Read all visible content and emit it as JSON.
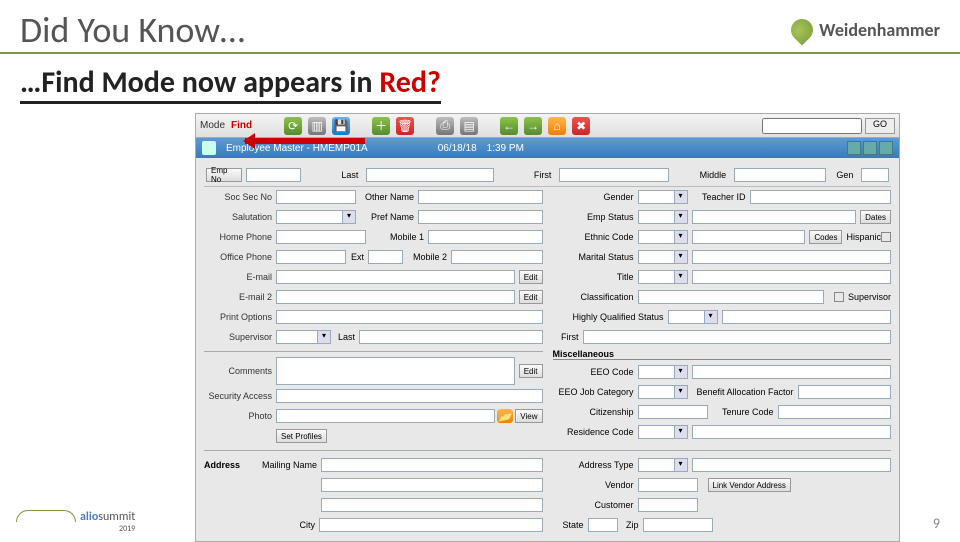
{
  "slide": {
    "title": "Did You Know…",
    "brand": "Weidenhammer",
    "subtitle_prefix": "…Find Mode now appears in ",
    "subtitle_red": "Red?",
    "footer": {
      "alio": "alio",
      "summit": "summit",
      "year": "2019"
    },
    "page": "9"
  },
  "toolbar": {
    "mode_label": "Mode",
    "mode_value": "Find",
    "go": "GO"
  },
  "tabbar": {
    "title": "Employee Master - HMEMP01A",
    "date": "06/18/18",
    "time": "1:39 PM"
  },
  "labels": {
    "emp_no": "Emp No",
    "last": "Last",
    "first": "First",
    "middle": "Middle",
    "gen": "Gen",
    "soc_sec": "Soc Sec No",
    "other_name": "Other Name",
    "gender": "Gender",
    "teacher_id": "Teacher ID",
    "salutation": "Salutation",
    "pref_name": "Pref Name",
    "emp_status": "Emp Status",
    "dates": "Dates",
    "home_phone": "Home Phone",
    "mobile1": "Mobile 1",
    "ethnic": "Ethnic Code",
    "codes": "Codes",
    "hispanic": "Hispanic",
    "office_phone": "Office Phone",
    "ext": "Ext",
    "mobile2": "Mobile 2",
    "marital": "Marital Status",
    "email": "E-mail",
    "edit": "Edit",
    "title": "Title",
    "email2": "E-mail 2",
    "classification": "Classification",
    "supervisor_chk": "Supervisor",
    "print_options": "Print Options",
    "hq_status": "Highly Qualified Status",
    "supervisor": "Supervisor",
    "last2": "Last",
    "first2": "First",
    "misc": "Miscellaneous",
    "comments": "Comments",
    "eeo_code": "EEO Code",
    "security": "Security Access",
    "eeo_job": "EEO Job Category",
    "benefit": "Benefit Allocation Factor",
    "photo": "Photo",
    "view": "View",
    "citizenship": "Citizenship",
    "tenure": "Tenure Code",
    "set_profiles": "Set Profiles",
    "residence": "Residence Code",
    "address": "Address",
    "mailing_name": "Mailing Name",
    "address_type": "Address Type",
    "vendor": "Vendor",
    "link_vendor": "Link Vendor Address",
    "customer": "Customer",
    "city": "City",
    "state": "State",
    "zip": "Zip"
  }
}
